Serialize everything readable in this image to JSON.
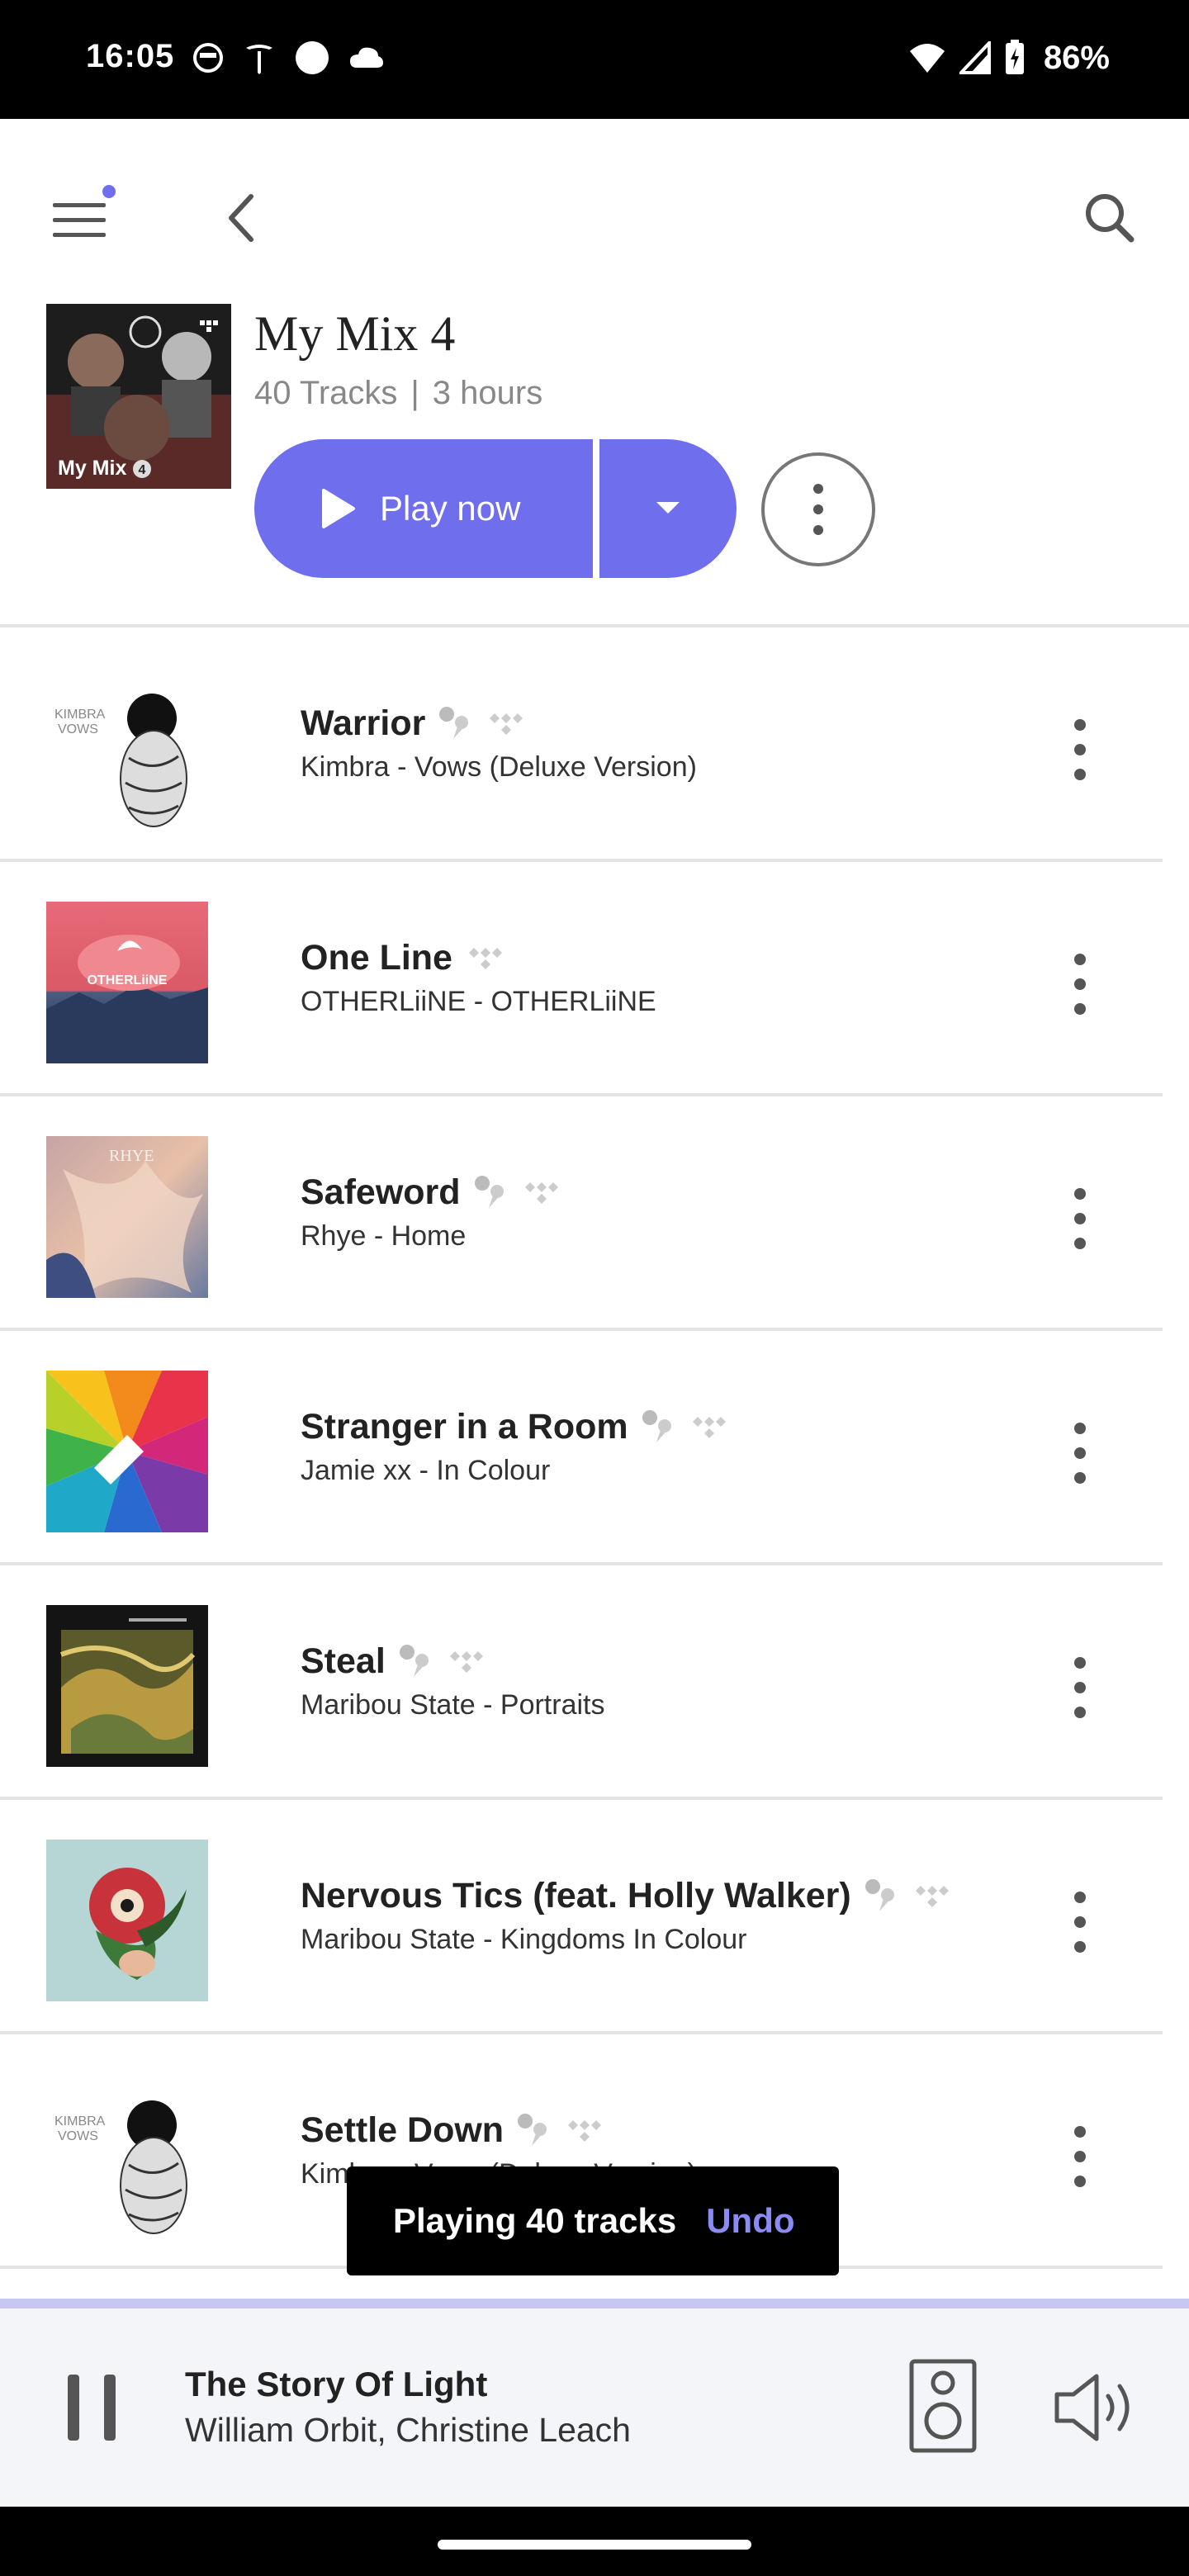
{
  "status_bar": {
    "time": "16:05",
    "battery": "86%"
  },
  "mix": {
    "title": "My Mix 4",
    "art_label": "My Mix",
    "track_count": "40 Tracks",
    "separator": "|",
    "duration": "3 hours",
    "play_label": "Play now"
  },
  "tracks": [
    {
      "title": "Warrior",
      "subtitle": "Kimbra - Vows (Deluxe Version)",
      "art": "kimbra-vows"
    },
    {
      "title": "One Line",
      "subtitle": "OTHERLiiNE - OTHERLiiNE",
      "art": "otherliine"
    },
    {
      "title": "Safeword",
      "subtitle": "Rhye - Home",
      "art": "rhye-home"
    },
    {
      "title": "Stranger in a Room",
      "subtitle": "Jamie xx - In Colour",
      "art": "in-colour"
    },
    {
      "title": "Steal",
      "subtitle": "Maribou State - Portraits",
      "art": "portraits"
    },
    {
      "title": "Nervous Tics (feat. Holly Walker)",
      "subtitle": "Maribou State - Kingdoms In Colour",
      "art": "kingdoms"
    },
    {
      "title": "Settle Down",
      "subtitle": "Kimbra - Vows (Deluxe Version)",
      "art": "kimbra-vows"
    }
  ],
  "art_text": {
    "kimbra_line1": "KIMBRA",
    "kimbra_line2": "VOWS",
    "otherliine": "OTHERLiiNE",
    "rhye": "RHYE"
  },
  "toast": {
    "message": "Playing 40 tracks",
    "action": "Undo"
  },
  "now_playing": {
    "title": "The Story Of Light",
    "artist": "William Orbit, Christine Leach"
  },
  "colors": {
    "accent": "#6f6fee",
    "progress": "#c7c7f2",
    "undo": "#8b8bf5"
  },
  "icons": [
    "menu-icon",
    "back-icon",
    "search-icon",
    "play-icon",
    "dropdown-icon",
    "more-icon",
    "download-icon",
    "tidal-icon",
    "pause-icon",
    "speaker-icon",
    "volume-icon"
  ]
}
